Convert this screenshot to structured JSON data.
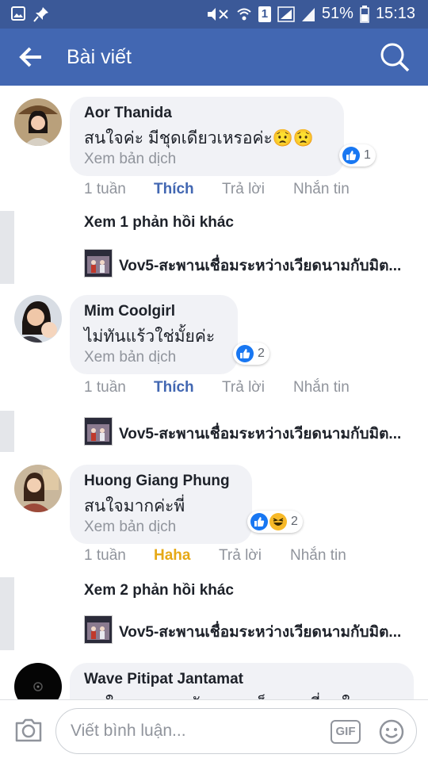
{
  "status_bar": {
    "battery": "51%",
    "time": "15:13",
    "sim_label": "1",
    "icons": [
      "gallery-icon",
      "pin-icon",
      "mute-icon",
      "wifi-icon",
      "signal-icon",
      "battery-icon"
    ]
  },
  "header": {
    "title": "Bài viết",
    "back_icon": "arrow-left-icon",
    "search_icon": "search-icon"
  },
  "comments": [
    {
      "name": "Aor Thanida",
      "text": "สนใจค่ะ มีชุดเดียวเหรอค่ะ😟😟",
      "translate": "Xem bản dịch",
      "reaction_count": "1",
      "time": "1 tuần",
      "reaction_action": "Thích",
      "reply": "Trả lời",
      "message": "Nhắn tin"
    },
    {
      "name": "Mim Coolgirl",
      "text": "ไม่ทันแร้วใช่มั้ยค่ะ",
      "translate": "Xem bản dịch",
      "reaction_count": "2",
      "time": "1 tuần",
      "reaction_action": "Thích",
      "reply": "Trả lời",
      "message": "Nhắn tin"
    },
    {
      "name": "Huong Giang Phung",
      "text": "สนใจมากค่ะพี่",
      "translate": "Xem bản dịch",
      "reaction_count": "2",
      "time": "1 tuần",
      "reaction_action": "Haha",
      "reply": "Trả lời",
      "message": "Nhắn tin"
    },
    {
      "name": "Wave Pitipat Jantamat",
      "text": "สนใจมากเลยครับแพรวเห็นภาพที่สนใจ"
    }
  ],
  "reply_threads": [
    {
      "more": "Xem 1 phản hồi khác",
      "preview": "Vov5-สะพานเชื่อมระหว่างเวียดนามกับมิต..."
    },
    {
      "more": "",
      "preview": "Vov5-สะพานเชื่อมระหว่างเวียดนามกับมิต..."
    },
    {
      "more": "Xem 2 phản hồi khác",
      "preview": "Vov5-สะพานเชื่อมระหว่างเวียดนามกับมิต..."
    }
  ],
  "composer": {
    "placeholder": "Viết bình luận...",
    "gif_label": "GIF",
    "camera_icon": "camera-icon",
    "emoji_icon": "emoji-icon"
  },
  "colors": {
    "status_bar": "#3b5998",
    "app_bar": "#4267b2",
    "like_blue": "#4267b2",
    "haha_yellow": "#e6a917",
    "bubble_bg": "#f1f2f6"
  }
}
